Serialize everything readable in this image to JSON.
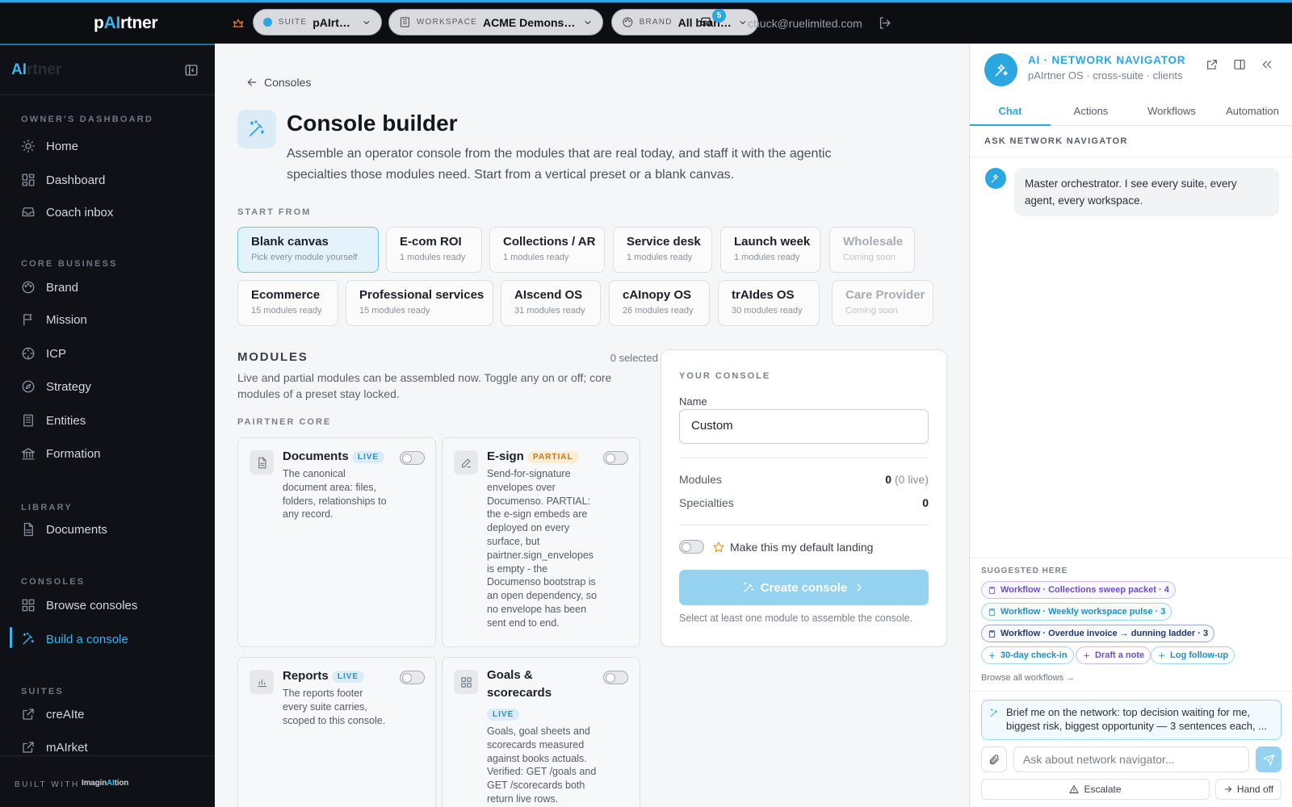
{
  "topbar": {
    "logo": {
      "pre": "p",
      "ai": "AI",
      "post": "rtner"
    },
    "suite": {
      "label": "SUITE",
      "value": "pAIrtner"
    },
    "workspace": {
      "label": "WORKSPACE",
      "value": "ACME Demonst..."
    },
    "brand": {
      "label": "BRAND",
      "value": "All brands"
    },
    "notifications_count": "5",
    "email": "chuck@ruelimited.com"
  },
  "sidebar": {
    "logo": {
      "ai": "AI",
      "post": "rtner"
    },
    "sections": {
      "owners": "OWNER'S DASHBOARD",
      "core": "CORE BUSINESS",
      "library": "LIBRARY",
      "consoles": "CONSOLES",
      "suites": "SUITES"
    },
    "items": {
      "home": "Home",
      "dashboard": "Dashboard",
      "coach_inbox": "Coach inbox",
      "brand": "Brand",
      "mission": "Mission",
      "icp": "ICP",
      "strategy": "Strategy",
      "entities": "Entities",
      "formation": "Formation",
      "documents": "Documents",
      "browse_consoles": "Browse consoles",
      "build_console": "Build a console",
      "create": "creAIte",
      "market": "mAIrket"
    },
    "footer": {
      "built_with": "BUILT WITH",
      "brand_pre": "Imagin",
      "brand_ai": "AI",
      "brand_post": "tion"
    }
  },
  "main": {
    "back_label": "Consoles",
    "title": "Console builder",
    "description": "Assemble an operator console from the modules that are real today, and staff it with the agentic specialties those modules need. Start from a vertical preset or a blank canvas.",
    "start_from_label": "START FROM",
    "presets": [
      {
        "name": "Blank canvas",
        "sub": "Pick every module yourself"
      },
      {
        "name": "E-com ROI",
        "sub": "1 modules ready"
      },
      {
        "name": "Collections / AR",
        "sub": "1 modules ready"
      },
      {
        "name": "Service desk",
        "sub": "1 modules ready"
      },
      {
        "name": "Launch week",
        "sub": "1 modules ready"
      },
      {
        "name": "Wholesale",
        "sub": "Coming soon"
      },
      {
        "name": "Ecommerce",
        "sub": "15 modules ready"
      },
      {
        "name": "Professional services",
        "sub": "15 modules ready"
      },
      {
        "name": "AIscend OS",
        "sub": "31 modules ready"
      },
      {
        "name": "cAInopy OS",
        "sub": "26 modules ready"
      },
      {
        "name": "trAIdes OS",
        "sub": "30 modules ready"
      },
      {
        "name": "Care Provider",
        "sub": "Coming soon"
      }
    ],
    "modules_heading": "MODULES",
    "selected_count": "0 selected",
    "modules_description": "Live and partial modules can be assembled now. Toggle any on or off; core modules of a preset stay locked.",
    "core_label": "PAIRTNER CORE",
    "modules": [
      {
        "name": "Documents",
        "status": "LIVE",
        "desc": "The canonical document area: files, folders, relationships to any record."
      },
      {
        "name": "E-sign",
        "status": "PARTIAL",
        "desc": "Send-for-signature envelopes over Documenso. PARTIAL: the e-sign embeds are deployed on every surface, but pairtner.sign_envelopes is empty - the Documenso bootstrap is an open dependency, so no envelope has been sent end to end."
      },
      {
        "name": "Reports",
        "status": "LIVE",
        "desc": "The reports footer every suite carries, scoped to this console."
      },
      {
        "name": "Goals & scorecards",
        "status": "LIVE",
        "desc": "Goals, goal sheets and scorecards measured against books actuals. Verified: GET /goals and GET /scorecards both return live rows."
      }
    ]
  },
  "console": {
    "heading": "YOUR CONSOLE",
    "name_label": "Name",
    "name_value": "Custom",
    "modules_label": "Modules",
    "modules_value": "0",
    "modules_sub": "(0 live)",
    "specialties_label": "Specialties",
    "specialties_value": "0",
    "default_label": "Make this my default landing",
    "create_label": "Create console",
    "hint": "Select at least one module to assemble the console."
  },
  "assistant": {
    "title": "AI · NETWORK NAVIGATOR",
    "subtitle": "pAIrtner OS · cross-suite · clients",
    "tabs": [
      "Chat",
      "Actions",
      "Workflows",
      "Automation"
    ],
    "ask_label": "ASK NETWORK NAVIGATOR",
    "message": "Master orchestrator. I see every suite, every agent, every workspace.",
    "suggested_label": "SUGGESTED HERE",
    "workflows": [
      "Workflow · Collections sweep packet · 4",
      "Workflow · Weekly workspace pulse · 3",
      "Workflow · Overdue invoice → dunning ladder · 3"
    ],
    "quick": [
      "30-day check-in",
      "Draft a note",
      "Log follow-up"
    ],
    "browse_label": "Browse all workflows →",
    "prompt": "Brief me on the network: top decision waiting for me, biggest risk, biggest opportunity — 3 sentences each, ...",
    "input_placeholder": "Ask about network navigator...",
    "escalate_label": "Escalate",
    "handoff_label": "Hand off"
  },
  "colors": {
    "accent": "#2aa6e0",
    "sidebar_bg": "#0f1117",
    "topbar_bg": "#0d0e12",
    "partial": "#c0771e"
  }
}
